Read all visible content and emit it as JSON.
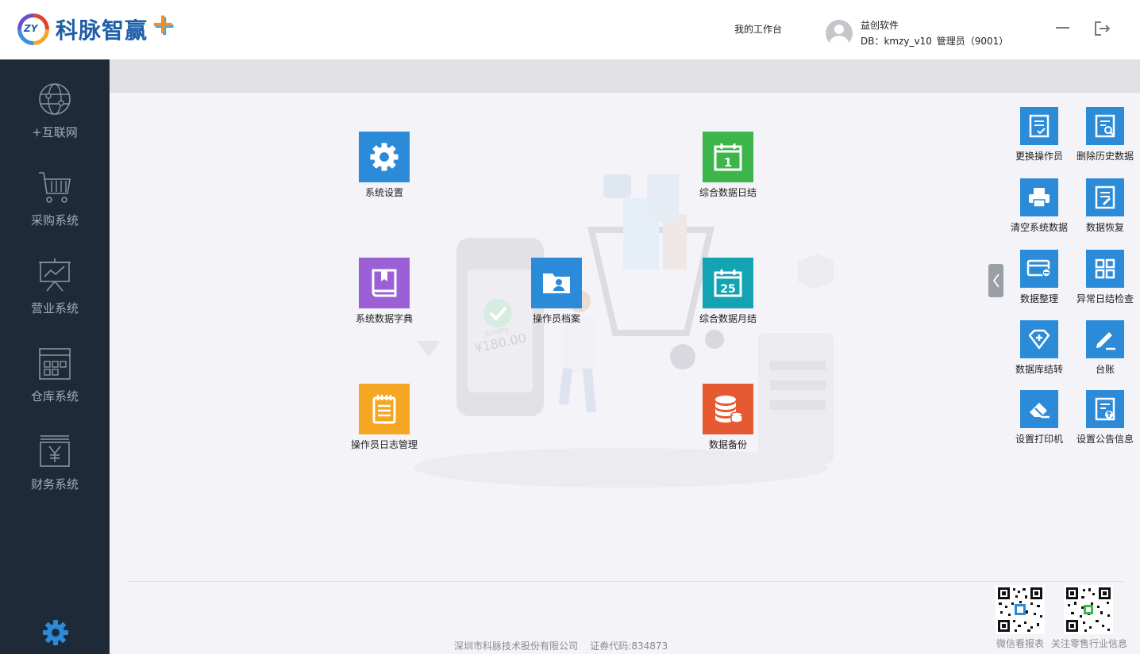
{
  "header": {
    "logo_text": "科脉智赢",
    "logo_badge": "ZY",
    "logo_plus": "+",
    "workbench_label": "我的工作台",
    "user_company": "益创软件",
    "user_db": "DB：kmzy_v10   管理员（9001）"
  },
  "sidebar": {
    "items": [
      {
        "label": "+互联网",
        "icon": "globe-icon"
      },
      {
        "label": "采购系统",
        "icon": "cart-icon"
      },
      {
        "label": "营业系统",
        "icon": "chart-board-icon"
      },
      {
        "label": "仓库系统",
        "icon": "warehouse-icon"
      },
      {
        "label": "财务系统",
        "icon": "yen-icon"
      }
    ],
    "settings_icon": "gear-icon"
  },
  "main": {
    "tiles": [
      {
        "label": "系统设置",
        "icon": "gear-icon",
        "color": "#2b8bd8"
      },
      {
        "label": "综合数据日结",
        "icon": "calendar-day-icon",
        "color": "#3cb54a",
        "number": "1"
      },
      {
        "label": "系统数据字典",
        "icon": "book-icon",
        "color": "#9b5fd6"
      },
      {
        "label": "操作员档案",
        "icon": "folder-user-icon",
        "color": "#2b8bd8"
      },
      {
        "label": "综合数据月结",
        "icon": "calendar-month-icon",
        "color": "#13a3b3",
        "number": "25"
      },
      {
        "label": "操作员日志管理",
        "icon": "notepad-icon",
        "color": "#f5a623"
      },
      {
        "label": "数据备份",
        "icon": "database-icon",
        "color": "#e65a32"
      }
    ],
    "illustration_price": "¥180.00",
    "illustration_caption": "支付成功"
  },
  "tools": {
    "items": [
      {
        "label": "更换操作员",
        "icon": "doc-check-icon"
      },
      {
        "label": "删除历史数据",
        "icon": "doc-search-icon"
      },
      {
        "label": "清空系统数据",
        "icon": "printer-icon"
      },
      {
        "label": "数据恢复",
        "icon": "doc-edit-icon"
      },
      {
        "label": "数据整理",
        "icon": "card-minus-icon"
      },
      {
        "label": "异常日结检查",
        "icon": "grid-icon"
      },
      {
        "label": "数据库结转",
        "icon": "diamond-plus-icon"
      },
      {
        "label": "台账",
        "icon": "pencil-icon"
      },
      {
        "label": "设置打印机",
        "icon": "eraser-icon"
      },
      {
        "label": "设置公告信息",
        "icon": "doc-upload-icon"
      }
    ]
  },
  "footer": {
    "company": "深圳市科脉技术股份有限公司",
    "stock_code": "证券代码:834873",
    "qr_left_label": "微信看报表",
    "qr_right_label": "关注零售行业信息"
  },
  "colors": {
    "sidebar_bg": "#1e2a38",
    "accent_blue": "#2b8bd8",
    "green": "#3cb54a",
    "purple": "#9b5fd6",
    "teal": "#13a3b3",
    "orange": "#f5a623",
    "red": "#e65a32"
  }
}
